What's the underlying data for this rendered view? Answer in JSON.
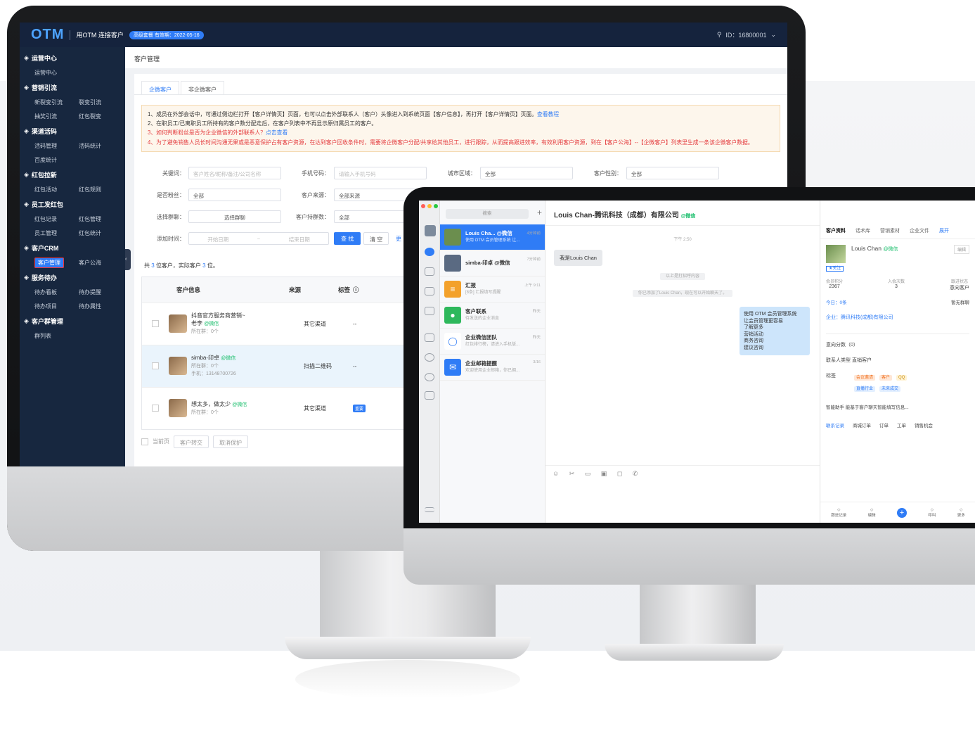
{
  "admin": {
    "brand": "OTM",
    "slogan": "用OTM 连接客户",
    "badge": "高级套餐 有效期：2022-05-16",
    "account": "ID：16800001",
    "sidebar": [
      {
        "group": "运营中心",
        "items": [
          "运营中心"
        ]
      },
      {
        "group": "营销引流",
        "items": [
          "新裂变引流",
          "裂变引流",
          "抽奖引流",
          "红包裂变"
        ]
      },
      {
        "group": "渠道活码",
        "items": [
          "活码管理",
          "活码统计",
          "百度统计"
        ]
      },
      {
        "group": "红包拉新",
        "items": [
          "红包活动",
          "红包规则"
        ]
      },
      {
        "group": "员工发红包",
        "items": [
          "红包记录",
          "红包管理",
          "员工管理",
          "红包统计"
        ]
      },
      {
        "group": "客户CRM",
        "items": [
          "客户管理",
          "客户公海"
        ]
      },
      {
        "group": "服务待办",
        "items": [
          "待办看板",
          "待办提醒",
          "待办项目",
          "待办属性"
        ]
      },
      {
        "group": "客户群管理",
        "items": [
          "群列表"
        ]
      }
    ],
    "breadcrumb": "客户管理",
    "tabs": [
      "企微客户",
      "非企微客户"
    ],
    "notice": [
      "1、成员在外部会话中，可通过侧边栏打开【客户详情页】页面，也可以点击外部联系人（客户）头像进入到系统页面【客户信息】，再打开【客户详情页】页面。",
      "查看教程",
      "2、在职员工/已离职员工所持有的客户数分配走后，在客户列表中不再显示原归属员工的客户。",
      "3、如何判断粉丝是否为企业微信的外部联系人？",
      "点击查看",
      "4、为了避免销售人员长时间沟通无果或是恶意保护占有客户资源，在达到客户回收条件时，需要将企微客户分配/共享给其他员工，进行跟踪，从而提高跟进效率，有效利用客户资源，到在【客户公海】--【企微客户】列表里生成一条该企微客户数据。"
    ],
    "filters": {
      "keyword_label": "关键词：",
      "keyword_ph": "客户姓名/昵称/备注/公司名称",
      "phone_label": "手机号码：",
      "phone_ph": "请输入手机号码",
      "city_label": "城市区域：",
      "city_val": "全部",
      "gender_label": "客户性别：",
      "gender_val": "全部",
      "fan_label": "是否粉丝：",
      "fan_val": "全部",
      "source_label": "客户来源：",
      "source_val": "全部来源",
      "group_label": "选择群聊：",
      "group_val": "选择群聊",
      "hold_label": "客户持群数：",
      "hold_val": "全部",
      "time_label": "添加时间：",
      "start": "开始日期",
      "tilde": "~",
      "end": "结束日期",
      "search": "查 找",
      "clear": "清 空",
      "more": "更"
    },
    "count_pre": "共",
    "count_num": "3",
    "count_mid": "位客户，实际客户",
    "count_num2": "3",
    "count_post": "位。",
    "table": {
      "headers": [
        "客户信息",
        "来源",
        "标签"
      ],
      "rows": [
        {
          "name": "抖音官方服务商营销~",
          "line2": "老李",
          "wx": "@微信",
          "line3": "所在群：0个",
          "line4": "",
          "source": "其它渠道",
          "tag": "--"
        },
        {
          "name": "simba-印卓",
          "line2": "",
          "wx": "@微信",
          "line3": "所在群：0个",
          "line4": "手机：13148700726",
          "source": "扫描二维码",
          "tag": "--"
        },
        {
          "name": "想太多，做太少",
          "line2": "",
          "wx": "@微信",
          "line3": "所在群：0个",
          "line4": "",
          "source": "其它渠道",
          "tag": "重要"
        }
      ]
    },
    "footer": [
      "当前页",
      "客户转交",
      "取消保护"
    ]
  },
  "chat": {
    "search_ph": "搜索",
    "list": [
      {
        "title": "Louis Cha... @微信",
        "sub": "使用 OTM 会员管理系统 让...",
        "time": "4分钟前",
        "color": "#6b8e4e",
        "glyph": ""
      },
      {
        "title": "simba-印卓 @微信",
        "sub": "",
        "time": "7分钟前",
        "color": "#5a6a82",
        "glyph": ""
      },
      {
        "title": "汇报",
        "sub": "[8条] 汇报填写提醒",
        "time": "上午 9:11",
        "color": "#f3a12b",
        "glyph": "≡"
      },
      {
        "title": "客户联系",
        "sub": "待发送的企业消息",
        "time": "昨天",
        "color": "#2eb85c",
        "glyph": "●"
      },
      {
        "title": "企业微信团队",
        "sub": "红包排行榜，请进入手机版...",
        "time": "昨天",
        "color": "#ffffff",
        "glyph": "◯"
      },
      {
        "title": "企业邮箱提醒",
        "sub": "欢迎使用企业邮箱，你已拥...",
        "time": "3/16",
        "color": "#2f7cf6",
        "glyph": "✉"
      }
    ],
    "title": "Louis Chan-腾讯科技（成都）有限公司",
    "title_wx": "@微信",
    "time": "下午 2:50",
    "bubble_left": "我是Louis Chan",
    "sys1": "以上是打招呼内容",
    "sys2": "你已添加了Louis Chan，现在可以开始聊天了。",
    "bubble_right": [
      "使用 OTM 会员管理系统",
      "让会员管理更容易",
      "了解更多",
      "营销活动",
      "商务咨询",
      "建议咨询"
    ],
    "tools": "☺ ✂ ▭ ▣ ◻ ✆",
    "right": {
      "tabs": [
        "客户资料",
        "话术库",
        "营销素材",
        "企业文件",
        "展开"
      ],
      "name": "Louis Chan",
      "wx": "@微信",
      "edit": "编辑",
      "follow": "★关注",
      "stats": [
        {
          "k": "会员积分",
          "v": "2367"
        },
        {
          "k": "入会次数",
          "v": "3"
        },
        {
          "k": "跟进状态",
          "v": "意向客户"
        }
      ],
      "today": "今日：0条",
      "nogroup": "暂无群聊",
      "company": "企业：腾讯科技(成都)有限公司",
      "intent": "意向分数（0）",
      "ctype": "联系人类型 直销客户",
      "tags_label": "标签",
      "tags": [
        "会议邀请",
        "客户",
        "QQ",
        "直播行业",
        "未来成交"
      ],
      "ai": "智能助手 能基于客户聊天智能填写信息...",
      "subtabs": [
        "联系记录",
        "商城订单",
        "订单",
        "工单",
        "销售机会"
      ],
      "bottom": [
        "跟进记录",
        "编辑",
        "",
        "呼叫",
        "更多"
      ]
    }
  }
}
